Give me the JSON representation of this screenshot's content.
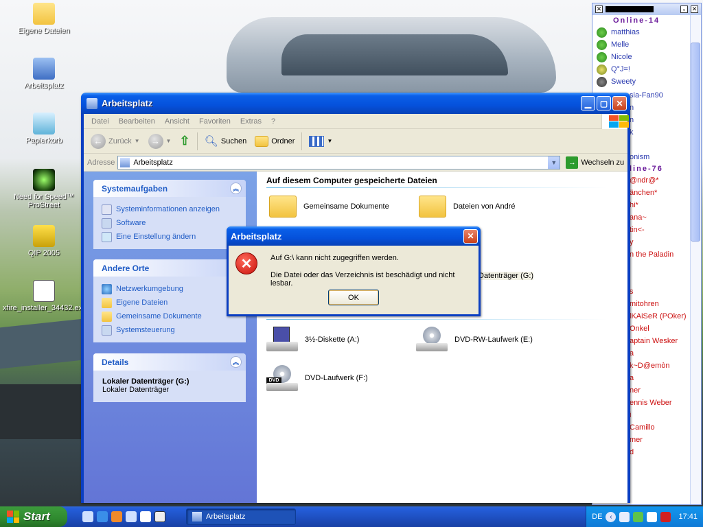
{
  "desktop": {
    "icons": [
      {
        "label": "Eigene Dateien"
      },
      {
        "label": "Arbeitsplatz"
      },
      {
        "label": "Papierkorb"
      },
      {
        "label": "Need for Speed™\nProStreet"
      },
      {
        "label": "QIP 2005"
      },
      {
        "label": "xfire_installer_34432.exe"
      }
    ]
  },
  "window": {
    "title": "Arbeitsplatz",
    "menu": [
      "Datei",
      "Bearbeiten",
      "Ansicht",
      "Favoriten",
      "Extras",
      "?"
    ],
    "toolbar": {
      "back": "Zurück",
      "search": "Suchen",
      "folders": "Ordner"
    },
    "address": {
      "label": "Adresse",
      "value": "Arbeitsplatz",
      "go": "Wechseln zu"
    },
    "tasks": {
      "title": "Systemaufgaben",
      "items": [
        "Systeminformationen anzeigen",
        "Software",
        "Eine Einstellung ändern"
      ]
    },
    "places": {
      "title": "Andere Orte",
      "items": [
        "Netzwerkumgebung",
        "Eigene Dateien",
        "Gemeinsame Dokumente",
        "Systemsteuerung"
      ]
    },
    "details": {
      "title": "Details",
      "name": "Lokaler Datenträger (G:)",
      "type": "Lokaler Datenträger"
    },
    "stored_section": "Auf diesem Computer gespeicherte Dateien",
    "stored_items": [
      "Gemeinsame Dokumente",
      "Dateien von André"
    ],
    "partial_hdd": "Datenträger (G:)",
    "removable_section": "Geräte mit Wechselmedien",
    "removable_items": [
      "3½-Diskette (A:)",
      "DVD-RW-Laufwerk (E:)",
      "DVD-Laufwerk (F:)"
    ]
  },
  "dialog": {
    "title": "Arbeitsplatz",
    "line1": "Auf G:\\ kann nicht zugegriffen werden.",
    "line2": "Die Datei oder das Verzeichnis ist beschädigt und nicht lesbar.",
    "ok": "OK"
  },
  "qip": {
    "group1": "Online-14",
    "online": [
      "matthias",
      "Melle",
      "Nicole",
      "Q°J=!",
      "Sweety"
    ],
    "partial1": [
      "sia-Fan90",
      "n",
      "n",
      "k",
      "",
      "onism"
    ],
    "group2": "line-76",
    "partial2": [
      "@ndr@*",
      "änchen*",
      "hi*",
      "ana~",
      "tin<-",
      "y",
      "n the Paladin",
      "",
      "",
      "s",
      "mitohren",
      "lKAiSeR (POker)",
      "Onkel",
      "aptain Wesker",
      "a",
      "k~D@emòn",
      "a",
      "ner",
      "ennis Weber",
      "i",
      "Camillo",
      "mer",
      "d"
    ]
  },
  "taskbar": {
    "start": "Start",
    "task": "Arbeitsplatz",
    "lang": "DE",
    "time": "17:41"
  }
}
